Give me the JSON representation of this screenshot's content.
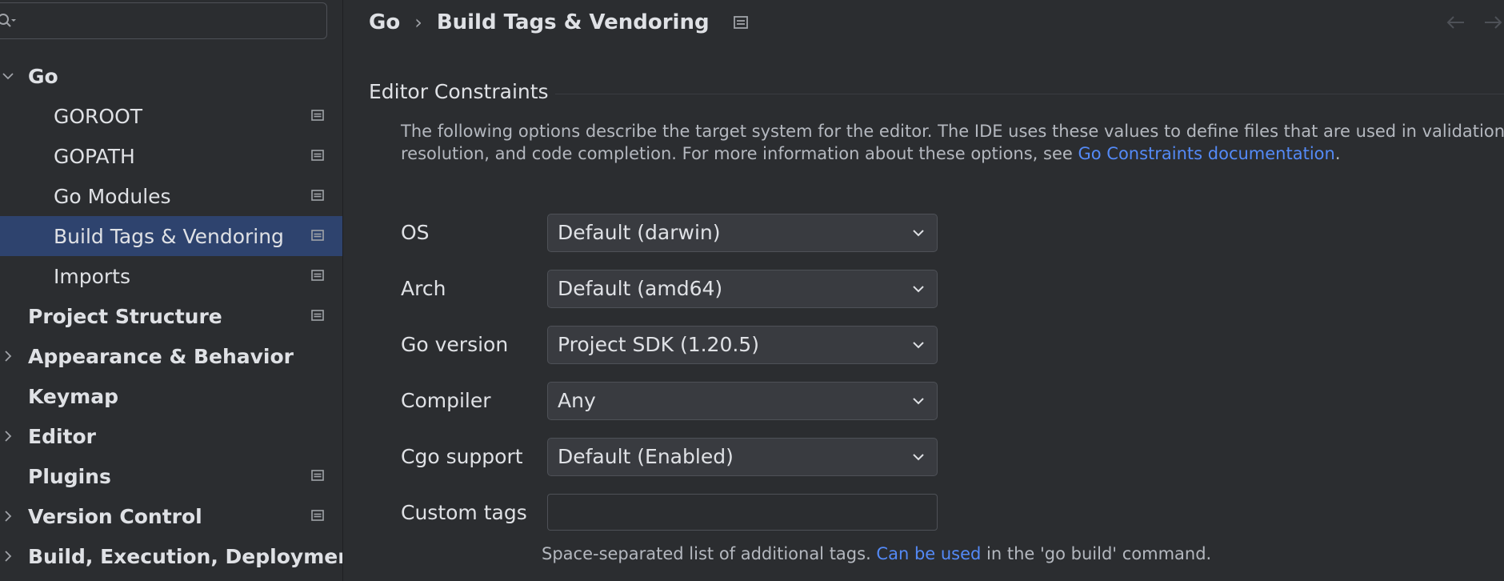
{
  "search": {
    "placeholder": ""
  },
  "sidebar": {
    "items": [
      {
        "label": "Go",
        "level": 0,
        "expanded": true,
        "bold": true,
        "has_chevron": true,
        "chevron": "down",
        "project_icon": false,
        "selected": false
      },
      {
        "label": "GOROOT",
        "level": 1,
        "bold": false,
        "has_chevron": false,
        "project_icon": true,
        "selected": false
      },
      {
        "label": "GOPATH",
        "level": 1,
        "bold": false,
        "has_chevron": false,
        "project_icon": true,
        "selected": false
      },
      {
        "label": "Go Modules",
        "level": 1,
        "bold": false,
        "has_chevron": false,
        "project_icon": true,
        "selected": false
      },
      {
        "label": "Build Tags & Vendoring",
        "level": 1,
        "bold": false,
        "has_chevron": false,
        "project_icon": true,
        "selected": true
      },
      {
        "label": "Imports",
        "level": 1,
        "bold": false,
        "has_chevron": false,
        "project_icon": true,
        "selected": false
      },
      {
        "label": "Project Structure",
        "level": 0,
        "bold": true,
        "has_chevron": false,
        "project_icon": true,
        "selected": false
      },
      {
        "label": "Appearance & Behavior",
        "level": 0,
        "bold": true,
        "has_chevron": true,
        "chevron": "right",
        "project_icon": false,
        "selected": false
      },
      {
        "label": "Keymap",
        "level": 0,
        "bold": true,
        "has_chevron": false,
        "project_icon": false,
        "selected": false
      },
      {
        "label": "Editor",
        "level": 0,
        "bold": true,
        "has_chevron": true,
        "chevron": "right",
        "project_icon": false,
        "selected": false
      },
      {
        "label": "Plugins",
        "level": 0,
        "bold": true,
        "has_chevron": false,
        "project_icon": true,
        "selected": false
      },
      {
        "label": "Version Control",
        "level": 0,
        "bold": true,
        "has_chevron": true,
        "chevron": "right",
        "project_icon": true,
        "selected": false
      },
      {
        "label": "Build, Execution, Deployment",
        "level": 0,
        "bold": true,
        "has_chevron": true,
        "chevron": "right",
        "project_icon": false,
        "selected": false
      }
    ]
  },
  "breadcrumb": {
    "parent": "Go",
    "separator": "›",
    "current": "Build Tags & Vendoring"
  },
  "section": {
    "title": "Editor Constraints",
    "description_line1": "The following options describe the target system for the editor. The IDE uses these values to define files that are used in validation,",
    "description_line2_prefix": "resolution, and code completion. For more information about these options, see ",
    "description_link": "Go Constraints documentation",
    "description_line2_suffix": "."
  },
  "form": {
    "os_label": "OS",
    "os_value": "Default (darwin)",
    "arch_label": "Arch",
    "arch_value": "Default (amd64)",
    "go_version_label": "Go version",
    "go_version_value": "Project SDK (1.20.5)",
    "compiler_label": "Compiler",
    "compiler_value": "Any",
    "cgo_label": "Cgo support",
    "cgo_value": "Default (Enabled)",
    "custom_tags_label": "Custom tags",
    "custom_tags_value": ""
  },
  "hint": {
    "prefix": "Space-separated list of additional tags. ",
    "link": "Can be used",
    "suffix": " in the 'go build' command."
  },
  "colors": {
    "background": "#2b2d30",
    "selection": "#2e436e",
    "link": "#548af7",
    "text": "#dfe1e5",
    "muted_text": "#b4b8bf",
    "field_bg": "#393b40",
    "field_border": "#4e5157"
  }
}
